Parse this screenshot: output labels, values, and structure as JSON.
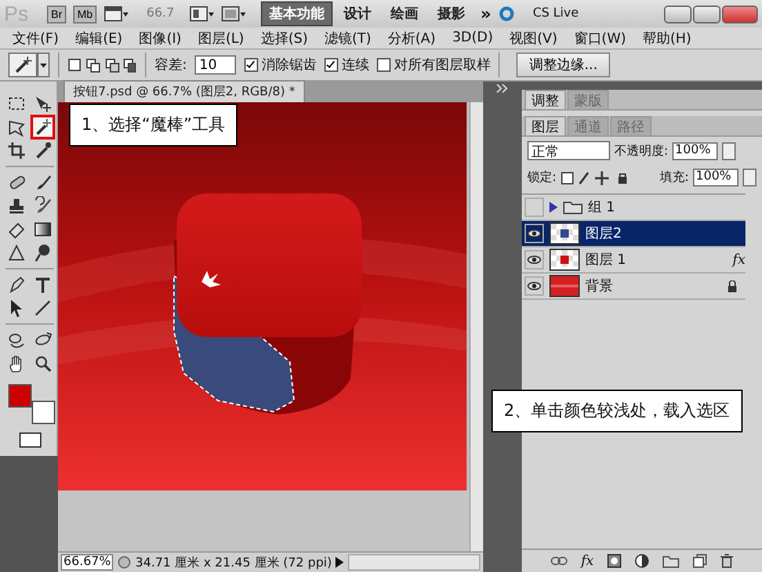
{
  "title_bar": {
    "logo": "Ps",
    "app_buttons": [
      "Br",
      "Mb"
    ],
    "zoom": "66.7",
    "more": "»",
    "cs_live": "CS Live",
    "workspaces": [
      {
        "label": "基本功能",
        "selected": true
      },
      {
        "label": "设计",
        "selected": false
      },
      {
        "label": "绘画",
        "selected": false
      },
      {
        "label": "摄影",
        "selected": false
      }
    ]
  },
  "menu": [
    "文件(F)",
    "编辑(E)",
    "图像(I)",
    "图层(L)",
    "选择(S)",
    "滤镜(T)",
    "分析(A)",
    "3D(D)",
    "视图(V)",
    "窗口(W)",
    "帮助(H)"
  ],
  "options_bar": {
    "tolerance_label": "容差:",
    "tolerance": "10",
    "refine_button": "调整边缘...",
    "checkboxes": [
      {
        "label": "消除锯齿",
        "checked": true
      },
      {
        "label": "连续",
        "checked": true
      },
      {
        "label": "对所有图层取样",
        "checked": false
      }
    ]
  },
  "tools": [
    {
      "kind": "marquee",
      "selected": false
    },
    {
      "kind": "move",
      "selected": false
    },
    {
      "kind": "lasso",
      "selected": false
    },
    {
      "kind": "wand",
      "selected": true
    },
    {
      "kind": "crop",
      "selected": false
    },
    {
      "kind": "eyedropper",
      "selected": false
    },
    {
      "kind": "healing",
      "selected": false
    },
    {
      "kind": "brush",
      "selected": false
    },
    {
      "kind": "stamp",
      "selected": false
    },
    {
      "kind": "history",
      "selected": false
    },
    {
      "kind": "eraser",
      "selected": false
    },
    {
      "kind": "gradient",
      "selected": false
    },
    {
      "kind": "blur",
      "selected": false
    },
    {
      "kind": "dodge",
      "selected": false
    },
    {
      "kind": "pen",
      "selected": false
    },
    {
      "kind": "type",
      "selected": false
    },
    {
      "kind": "select",
      "selected": false
    },
    {
      "kind": "line",
      "selected": false
    },
    {
      "kind": "rotate3d",
      "selected": false
    },
    {
      "kind": "orbit3d",
      "selected": false
    },
    {
      "kind": "hand",
      "selected": false
    },
    {
      "kind": "zoom",
      "selected": false
    }
  ],
  "swatches": [
    {
      "kind": "foreground",
      "color": "#cc0000"
    },
    {
      "kind": "background",
      "color": "#ffffff"
    }
  ],
  "document": {
    "tab": "按钮7.psd @ 66.7% (图层2, RGB/8) *",
    "zoom": "66.67%",
    "info": "34.71 厘米 x 21.45 厘米 (72 ppi)"
  },
  "callouts": [
    "1、选择“魔棒”工具",
    "2、单击颜色较浅处，载入选区"
  ],
  "panels": {
    "top_tabs": [
      {
        "label": "调整",
        "selected": true
      },
      {
        "label": "蒙版",
        "selected": false
      }
    ],
    "layer_tabs": [
      {
        "label": "图层",
        "selected": true
      },
      {
        "label": "通道",
        "selected": false
      },
      {
        "label": "路径",
        "selected": false
      }
    ],
    "blend_mode": "正常",
    "opacity_label": "不透明度:",
    "opacity": "100%",
    "lock_label": "锁定:",
    "fill_label": "填充:",
    "fill": "100%",
    "footer_fx": "fx",
    "layers": [
      {
        "name": "组 1",
        "kind": "group",
        "expanded": false,
        "visible": false,
        "selected": false,
        "locked": false
      },
      {
        "name": "图层2",
        "kind": "layer",
        "color": "#334a8a",
        "visible": true,
        "selected": true,
        "locked": false
      },
      {
        "name": "图层 1",
        "kind": "layer",
        "color": "#d01010",
        "badge": "fx",
        "visible": true,
        "selected": false,
        "locked": false
      },
      {
        "name": "背景",
        "kind": "background",
        "visible": true,
        "selected": false,
        "locked": true
      }
    ]
  }
}
